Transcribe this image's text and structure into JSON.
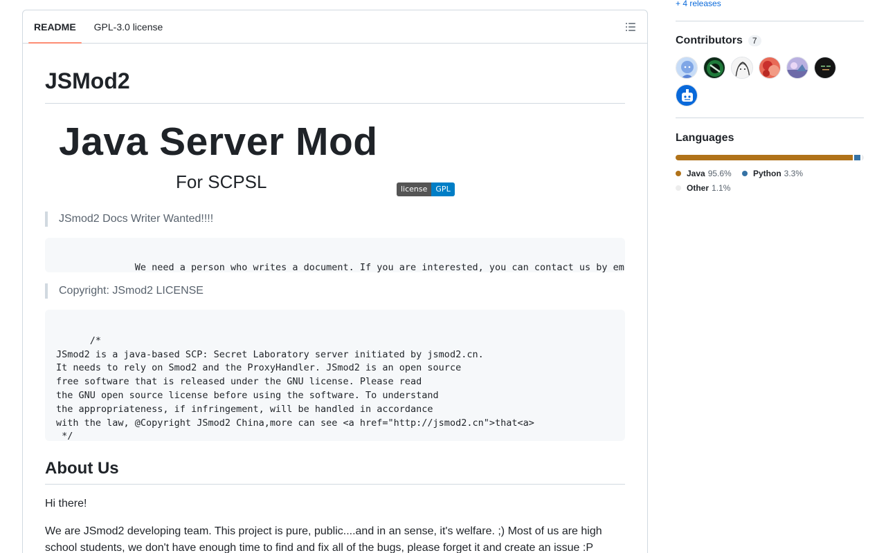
{
  "readme": {
    "tabs": [
      {
        "label": "README",
        "active": true
      },
      {
        "label": "GPL-3.0 license",
        "active": false
      }
    ],
    "outline_icon": "list-unordered-icon",
    "title": "JSMod2",
    "hero_title": "Java Server Mod",
    "hero_subtitle": "For SCPSL",
    "badge": {
      "left": "license",
      "right": "GPL"
    },
    "quote1": "JSmod2 Docs Writer Wanted!!!!",
    "code1": "We need a person who writes a document. If you are interested, you can contact us by em",
    "quote2": "Copyright: JSmod2 LICENSE",
    "code2": "/*\nJSmod2 is a java-based SCP: Secret Laboratory server initiated by jsmod2.cn.\nIt needs to rely on Smod2 and the ProxyHandler. JSmod2 is an open source\nfree software that is released under the GNU license. Please read\nthe GNU open source license before using the software. To understand\nthe appropriateness, if infringement, will be handled in accordance\nwith the law, @Copyright JSmod2 China,more can see <a href=\"http://jsmod2.cn\">that<a>\n */",
    "copy_icon": "copy-icon",
    "about_heading": "About Us",
    "about_p1": "Hi there!",
    "about_p2": "We are JSmod2 developing team. This project is pure, public....and in an sense, it's welfare. ;) Most of us are high school students, we don't have enough time to find and fix all of the bugs, please forget it and create an issue :P"
  },
  "sidebar": {
    "releases_link": "+ 4 releases",
    "contributors": {
      "heading": "Contributors",
      "count": "7",
      "avatars": [
        {
          "name": "contributor-avatar-1",
          "color": "#a8c4f0"
        },
        {
          "name": "contributor-avatar-2",
          "color": "#1e4d2b"
        },
        {
          "name": "contributor-avatar-3",
          "color": "#e8e8e8"
        },
        {
          "name": "contributor-avatar-4",
          "color": "#d9483b"
        },
        {
          "name": "contributor-avatar-5",
          "color": "#9a8fc8"
        },
        {
          "name": "contributor-avatar-6",
          "color": "#151515"
        },
        {
          "name": "contributor-avatar-7",
          "color": "#0969da"
        }
      ]
    },
    "languages": {
      "heading": "Languages",
      "items": [
        {
          "name": "Java",
          "percent": "95.6%",
          "value": 95.6,
          "color": "#b07219"
        },
        {
          "name": "Python",
          "percent": "3.3%",
          "value": 3.3,
          "color": "#3572A5"
        },
        {
          "name": "Other",
          "percent": "1.1%",
          "value": 1.1,
          "color": "#ededed"
        }
      ]
    }
  }
}
